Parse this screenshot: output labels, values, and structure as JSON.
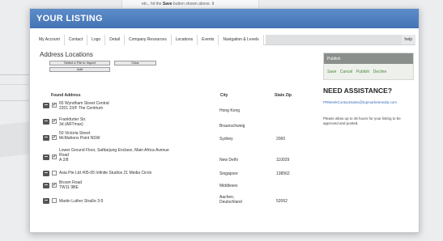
{
  "background": {
    "instruction_text": "etc., hit the ",
    "instruction_bold": "Save",
    "instruction_tail": " button shown above. It"
  },
  "window": {
    "title": "YOUR LISTING"
  },
  "tabs": [
    {
      "label": "My Account"
    },
    {
      "label": "Contact"
    },
    {
      "label": "Logo"
    },
    {
      "label": "Detail"
    },
    {
      "label": "Company Resources"
    },
    {
      "label": "Locations"
    },
    {
      "label": "Events"
    },
    {
      "label": "Navigation & Levels"
    }
  ],
  "help_tab": "help",
  "section": {
    "title": "Address Locations",
    "select_button": "Select a File to Import",
    "clear_button": "Clear",
    "add_button": "Add"
  },
  "table": {
    "headers": {
      "found_address": "Found Address",
      "city": "City",
      "state_zip": "State Zip"
    },
    "rows": [
      {
        "checked": "✔",
        "address": [
          "65 Wyndham Street Central",
          "2201 23/F The Centrium"
        ],
        "city": [
          "Hong Kong"
        ],
        "zip": ""
      },
      {
        "checked": "✔",
        "address": [
          "Frankfurter Str.",
          "3d (ARTmax)"
        ],
        "city": [
          "Braunschweig"
        ],
        "zip": ""
      },
      {
        "checked": "✔",
        "address": [
          "50 Victoria Street",
          "McMahons Point NSW"
        ],
        "city": [
          "Sydney"
        ],
        "zip": "2060"
      },
      {
        "checked": "✔",
        "address": [
          "Lower Ground Floor, Safdarjung Enclave, Main Africa Avenue",
          "Road",
          "A 2/8"
        ],
        "city": [
          "New Delhi"
        ],
        "zip": "110029"
      },
      {
        "checked": "",
        "address": [
          "Asia Pte Ltd #05-05 Infinite Studios 21 Media Circle"
        ],
        "city": [
          "Singapore"
        ],
        "zip": "138562"
      },
      {
        "checked": "✔",
        "address": [
          "Broom Road",
          "TW11 9BE"
        ],
        "city": [
          "Middlesex"
        ],
        "zip": ""
      },
      {
        "checked": "",
        "address": [
          "Martin Luther Straße 3-5"
        ],
        "city": [
          "Aachen,",
          "Deutschland"
        ],
        "zip": "52062"
      }
    ]
  },
  "panel": {
    "header": "Publish",
    "links": [
      "Save",
      "Cancel",
      "Publish",
      "Decline"
    ]
  },
  "assistance": {
    "title": "NEED ASSISTANCE?",
    "email": "PRWeekContactSales@topmarketmedia.com",
    "note": "Please allow up to 48 hours for your listing to be approved and posted."
  }
}
